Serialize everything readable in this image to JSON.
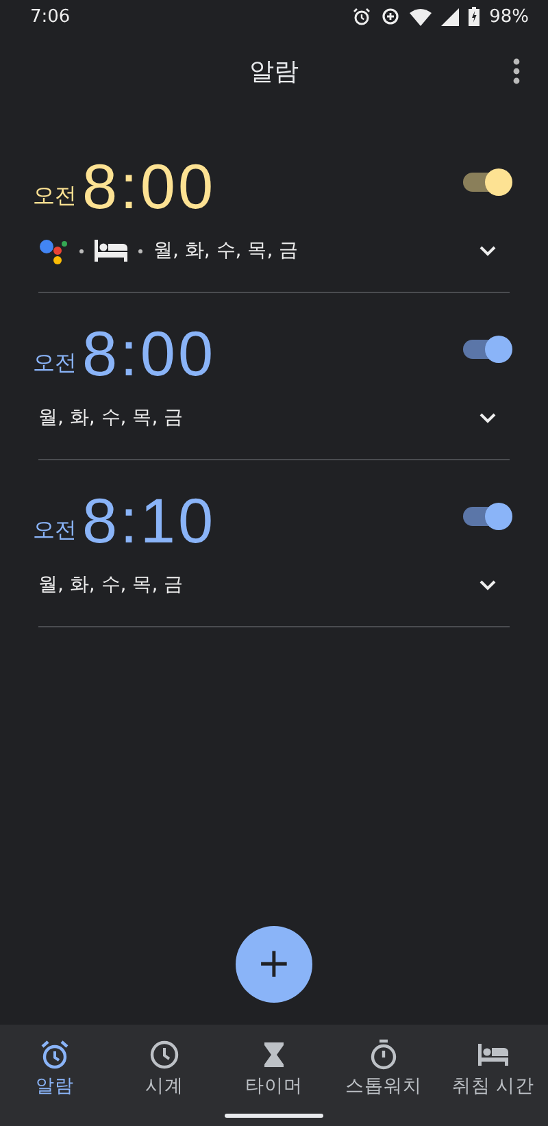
{
  "status_bar": {
    "time": "7:06",
    "battery": "98%"
  },
  "header": {
    "title": "알람"
  },
  "alarms": [
    {
      "kind": "bedtime",
      "period": "오전",
      "time": "8:00",
      "on": true,
      "days": "월, 화, 수, 목, 금"
    },
    {
      "kind": "normal",
      "period": "오전",
      "time": "8:00",
      "on": true,
      "days": "월, 화, 수, 목, 금"
    },
    {
      "kind": "normal",
      "period": "오전",
      "time": "8:10",
      "on": true,
      "days": "월, 화, 수, 목, 금"
    }
  ],
  "fab": {
    "label": "+"
  },
  "tabs": [
    {
      "label": "알람",
      "selected": true
    },
    {
      "label": "시계",
      "selected": false
    },
    {
      "label": "타이머",
      "selected": false
    },
    {
      "label": "스톱워치",
      "selected": false
    },
    {
      "label": "취침 시간",
      "selected": false
    }
  ]
}
